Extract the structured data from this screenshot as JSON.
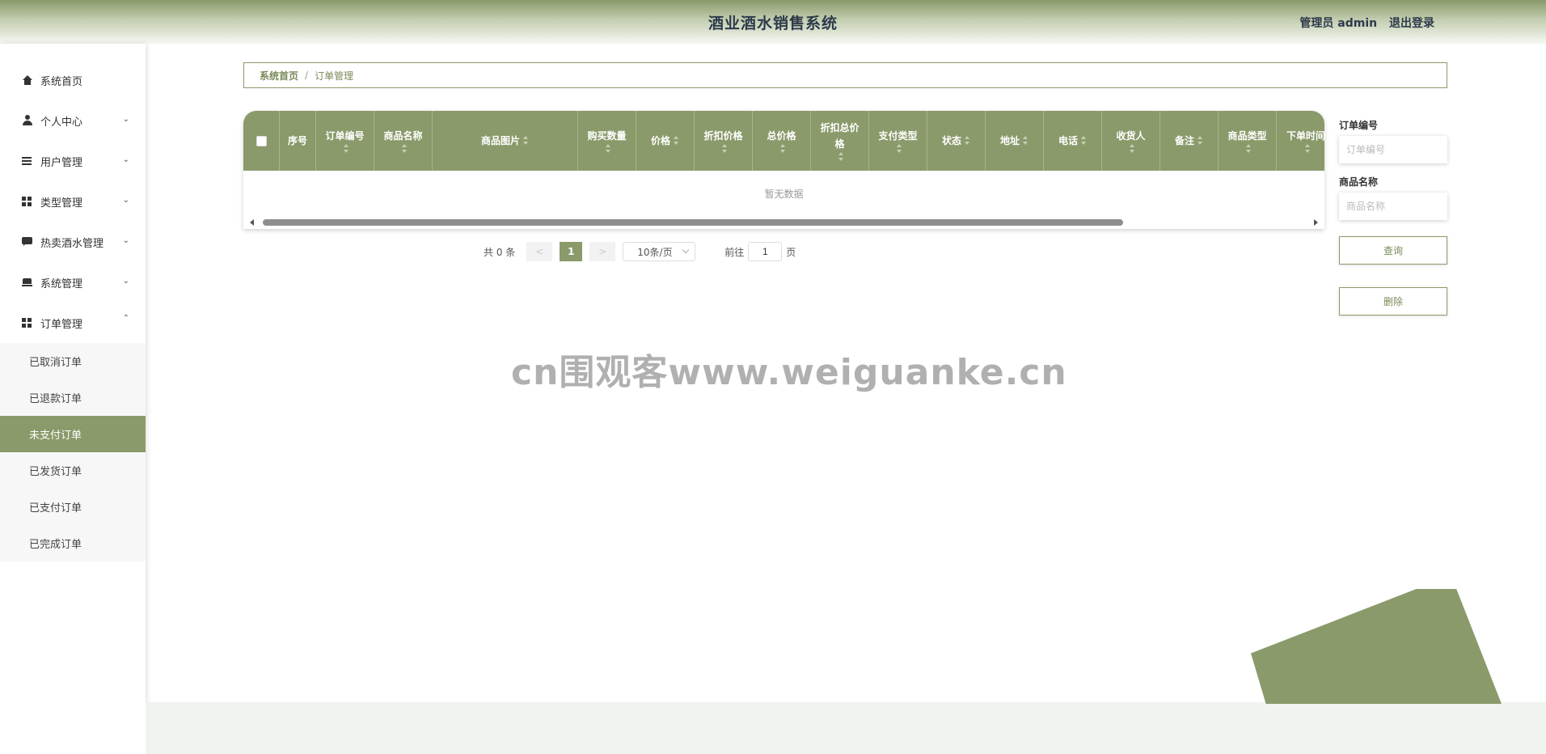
{
  "header": {
    "title": "酒业酒水销售系统",
    "user_label": "管理员 admin",
    "logout_label": "退出登录"
  },
  "sidebar": {
    "items": [
      {
        "label": "系统首页",
        "icon": "home-icon"
      },
      {
        "label": "个人中心",
        "icon": "user-icon"
      },
      {
        "label": "用户管理",
        "icon": "list-icon"
      },
      {
        "label": "类型管理",
        "icon": "grid-icon"
      },
      {
        "label": "热卖酒水管理",
        "icon": "chat-icon"
      },
      {
        "label": "系统管理",
        "icon": "system-icon"
      },
      {
        "label": "订单管理",
        "icon": "grid-icon"
      }
    ],
    "submenu": [
      {
        "label": "已取消订单"
      },
      {
        "label": "已退款订单"
      },
      {
        "label": "未支付订单"
      },
      {
        "label": "已发货订单"
      },
      {
        "label": "已支付订单"
      },
      {
        "label": "已完成订单"
      }
    ]
  },
  "breadcrumb": {
    "home": "系统首页",
    "separator": "/",
    "current": "订单管理"
  },
  "table": {
    "columns": [
      {
        "label": "序号"
      },
      {
        "label": "订单编号"
      },
      {
        "label": "商品名称"
      },
      {
        "label": "商品图片"
      },
      {
        "label": "购买数量"
      },
      {
        "label": "价格"
      },
      {
        "label": "折扣价格"
      },
      {
        "label": "总价格"
      },
      {
        "label": "折扣总价格"
      },
      {
        "label": "支付类型"
      },
      {
        "label": "状态"
      },
      {
        "label": "地址"
      },
      {
        "label": "电话"
      },
      {
        "label": "收货人"
      },
      {
        "label": "备注"
      },
      {
        "label": "商品类型"
      },
      {
        "label": "下单时间"
      }
    ],
    "empty_text": "暂无数据"
  },
  "pagination": {
    "total": "共 0 条",
    "prev": "<",
    "page": "1",
    "next": ">",
    "page_size": "10条/页",
    "goto_label": "前往",
    "goto_value": "1",
    "page_unit": "页"
  },
  "search": {
    "order_no_label": "订单编号",
    "order_no_placeholder": "订单编号",
    "product_label": "商品名称",
    "product_placeholder": "商品名称",
    "query_button": "查询",
    "delete_button": "删除"
  },
  "watermark": "cn围观客www.weiguanke.cn",
  "colors": {
    "accent": "#8a9a6a",
    "header_text": "#2d3a4a"
  }
}
